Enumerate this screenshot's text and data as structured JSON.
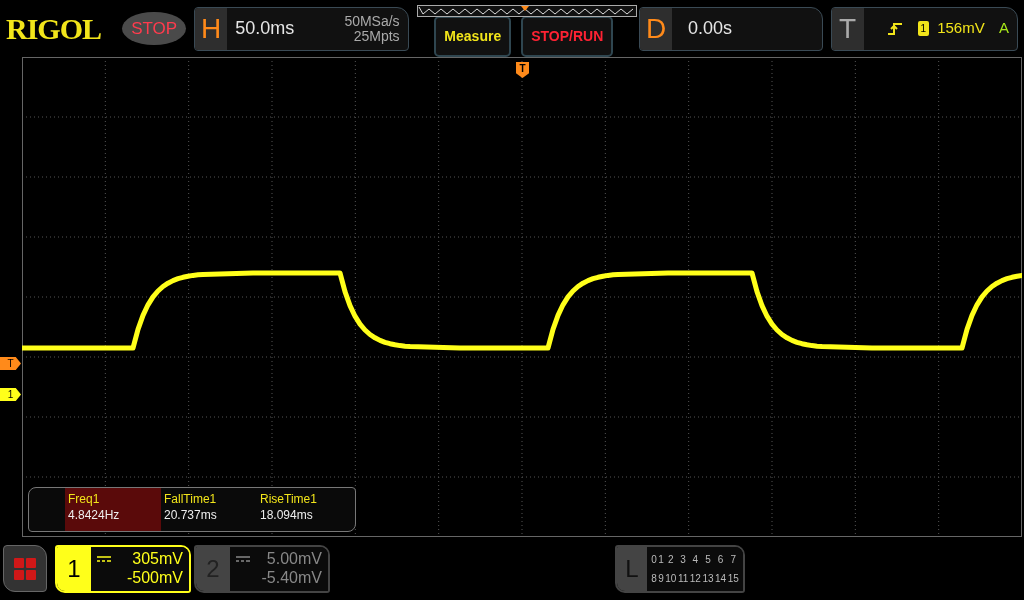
{
  "brand": {
    "logo": "RIGOL",
    "run_state": "STOP"
  },
  "horizontal": {
    "label": "H",
    "timebase": "50.0ms",
    "sample_rate": "50MSa/s",
    "memory_depth": "25Mpts"
  },
  "menu_buttons": [
    {
      "label": "Measure",
      "kind": "measure"
    },
    {
      "label": "STOP/RUN",
      "kind": "run"
    }
  ],
  "delay": {
    "label": "D",
    "value": "0.00s"
  },
  "trigger": {
    "label": "T",
    "source": "1",
    "level": "156mV",
    "mode": "A"
  },
  "screen_markers": [
    {
      "label": "T",
      "kind": "trigger-position"
    },
    {
      "label": "T",
      "kind": "trigger-level"
    },
    {
      "label": "1",
      "kind": "channel"
    }
  ],
  "measurements": [
    {
      "name": "Freq1",
      "value": "4.8424Hz",
      "selected": true
    },
    {
      "name": "FallTime1",
      "value": "20.737ms",
      "selected": false
    },
    {
      "name": "RiseTime1",
      "value": "18.094ms",
      "selected": false
    }
  ],
  "channels": [
    {
      "label": "1",
      "scale": "305mV",
      "offset": "-500mV",
      "on": true
    },
    {
      "label": "2",
      "scale": "5.00mV",
      "offset": "-5.40mV",
      "on": false
    }
  ],
  "logic": {
    "label": "L",
    "bits": [
      "0",
      "1",
      "2",
      "3",
      "4",
      "5",
      "6",
      "7",
      "8",
      "9",
      "10",
      "11",
      "12",
      "13",
      "14",
      "15"
    ]
  }
}
